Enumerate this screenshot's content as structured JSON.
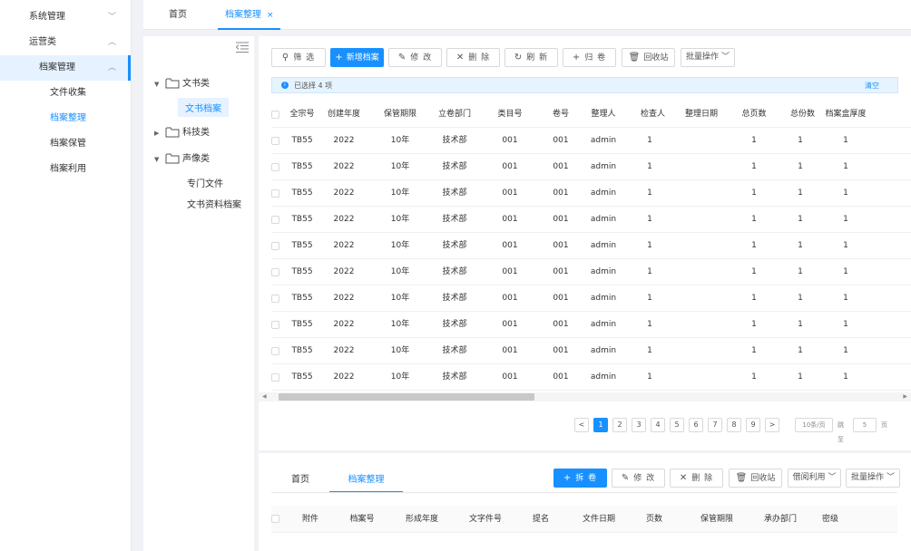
{
  "nav": {
    "items": [
      {
        "label": "系统管理",
        "chev": "﹀"
      },
      {
        "label": "运营类",
        "chev": "︿"
      },
      {
        "label": "档案管理",
        "chev": "︿"
      },
      {
        "label": "文件收集"
      },
      {
        "label": "档案整理"
      },
      {
        "label": "档案保管"
      },
      {
        "label": "档案利用"
      }
    ]
  },
  "tabs": {
    "home": "首页",
    "current": "档案整理",
    "close": "×"
  },
  "tree": {
    "nodes": [
      {
        "label": "文书类",
        "arrow": "▼"
      },
      {
        "label": "文书档案"
      },
      {
        "label": "科技类",
        "arrow": "▶"
      },
      {
        "label": "声像类",
        "arrow": "▼"
      },
      {
        "label": "专门文件"
      },
      {
        "label": "文书资料档案"
      }
    ]
  },
  "toolbar": {
    "filter": "筛 选",
    "add": "新增档案",
    "edit": "修 改",
    "delete": "删 除",
    "refresh": "刷 新",
    "archive": "归 卷",
    "recycle": "回收站",
    "batch": "批量操作"
  },
  "selection": {
    "text": "已选择 4 项",
    "clear": "清空"
  },
  "table": {
    "columns": [
      "全宗号",
      "创建年度",
      "保管期限",
      "立卷部门",
      "类目号",
      "卷号",
      "整理人",
      "检查人",
      "整理日期",
      "总页数",
      "总份数",
      "档案盒厚度"
    ],
    "rows": [
      [
        "TB55",
        "2022",
        "10年",
        "技术部",
        "001",
        "001",
        "admin",
        "1",
        "",
        "1",
        "1",
        "1"
      ],
      [
        "TB55",
        "2022",
        "10年",
        "技术部",
        "001",
        "001",
        "admin",
        "1",
        "",
        "1",
        "1",
        "1"
      ],
      [
        "TB55",
        "2022",
        "10年",
        "技术部",
        "001",
        "001",
        "admin",
        "1",
        "",
        "1",
        "1",
        "1"
      ],
      [
        "TB55",
        "2022",
        "10年",
        "技术部",
        "001",
        "001",
        "admin",
        "1",
        "",
        "1",
        "1",
        "1"
      ],
      [
        "TB55",
        "2022",
        "10年",
        "技术部",
        "001",
        "001",
        "admin",
        "1",
        "",
        "1",
        "1",
        "1"
      ],
      [
        "TB55",
        "2022",
        "10年",
        "技术部",
        "001",
        "001",
        "admin",
        "1",
        "",
        "1",
        "1",
        "1"
      ],
      [
        "TB55",
        "2022",
        "10年",
        "技术部",
        "001",
        "001",
        "admin",
        "1",
        "",
        "1",
        "1",
        "1"
      ],
      [
        "TB55",
        "2022",
        "10年",
        "技术部",
        "001",
        "001",
        "admin",
        "1",
        "",
        "1",
        "1",
        "1"
      ],
      [
        "TB55",
        "2022",
        "10年",
        "技术部",
        "001",
        "001",
        "admin",
        "1",
        "",
        "1",
        "1",
        "1"
      ],
      [
        "TB55",
        "2022",
        "10年",
        "技术部",
        "001",
        "001",
        "admin",
        "1",
        "",
        "1",
        "1",
        "1"
      ]
    ]
  },
  "pager": {
    "prev": "<",
    "next": ">",
    "pages": [
      "1",
      "2",
      "3",
      "4",
      "5",
      "6",
      "7",
      "8",
      "9"
    ],
    "current": "1",
    "size": "10条/页",
    "jump": "跳至",
    "jump_value": "5",
    "page_unit": "页"
  },
  "bottom": {
    "tabs": [
      "首页",
      "档案整理"
    ],
    "buttons": {
      "split": "拆 卷",
      "edit": "修 改",
      "delete": "删 除",
      "recycle": "回收站",
      "borrow": "借阅利用",
      "batch": "批量操作"
    },
    "columns": [
      "附件",
      "档案号",
      "形成年度",
      "文字件号",
      "提名",
      "文件日期",
      "页数",
      "保管期限",
      "承办部门",
      "密级"
    ]
  },
  "colors": {
    "accent": "#1890ff"
  }
}
